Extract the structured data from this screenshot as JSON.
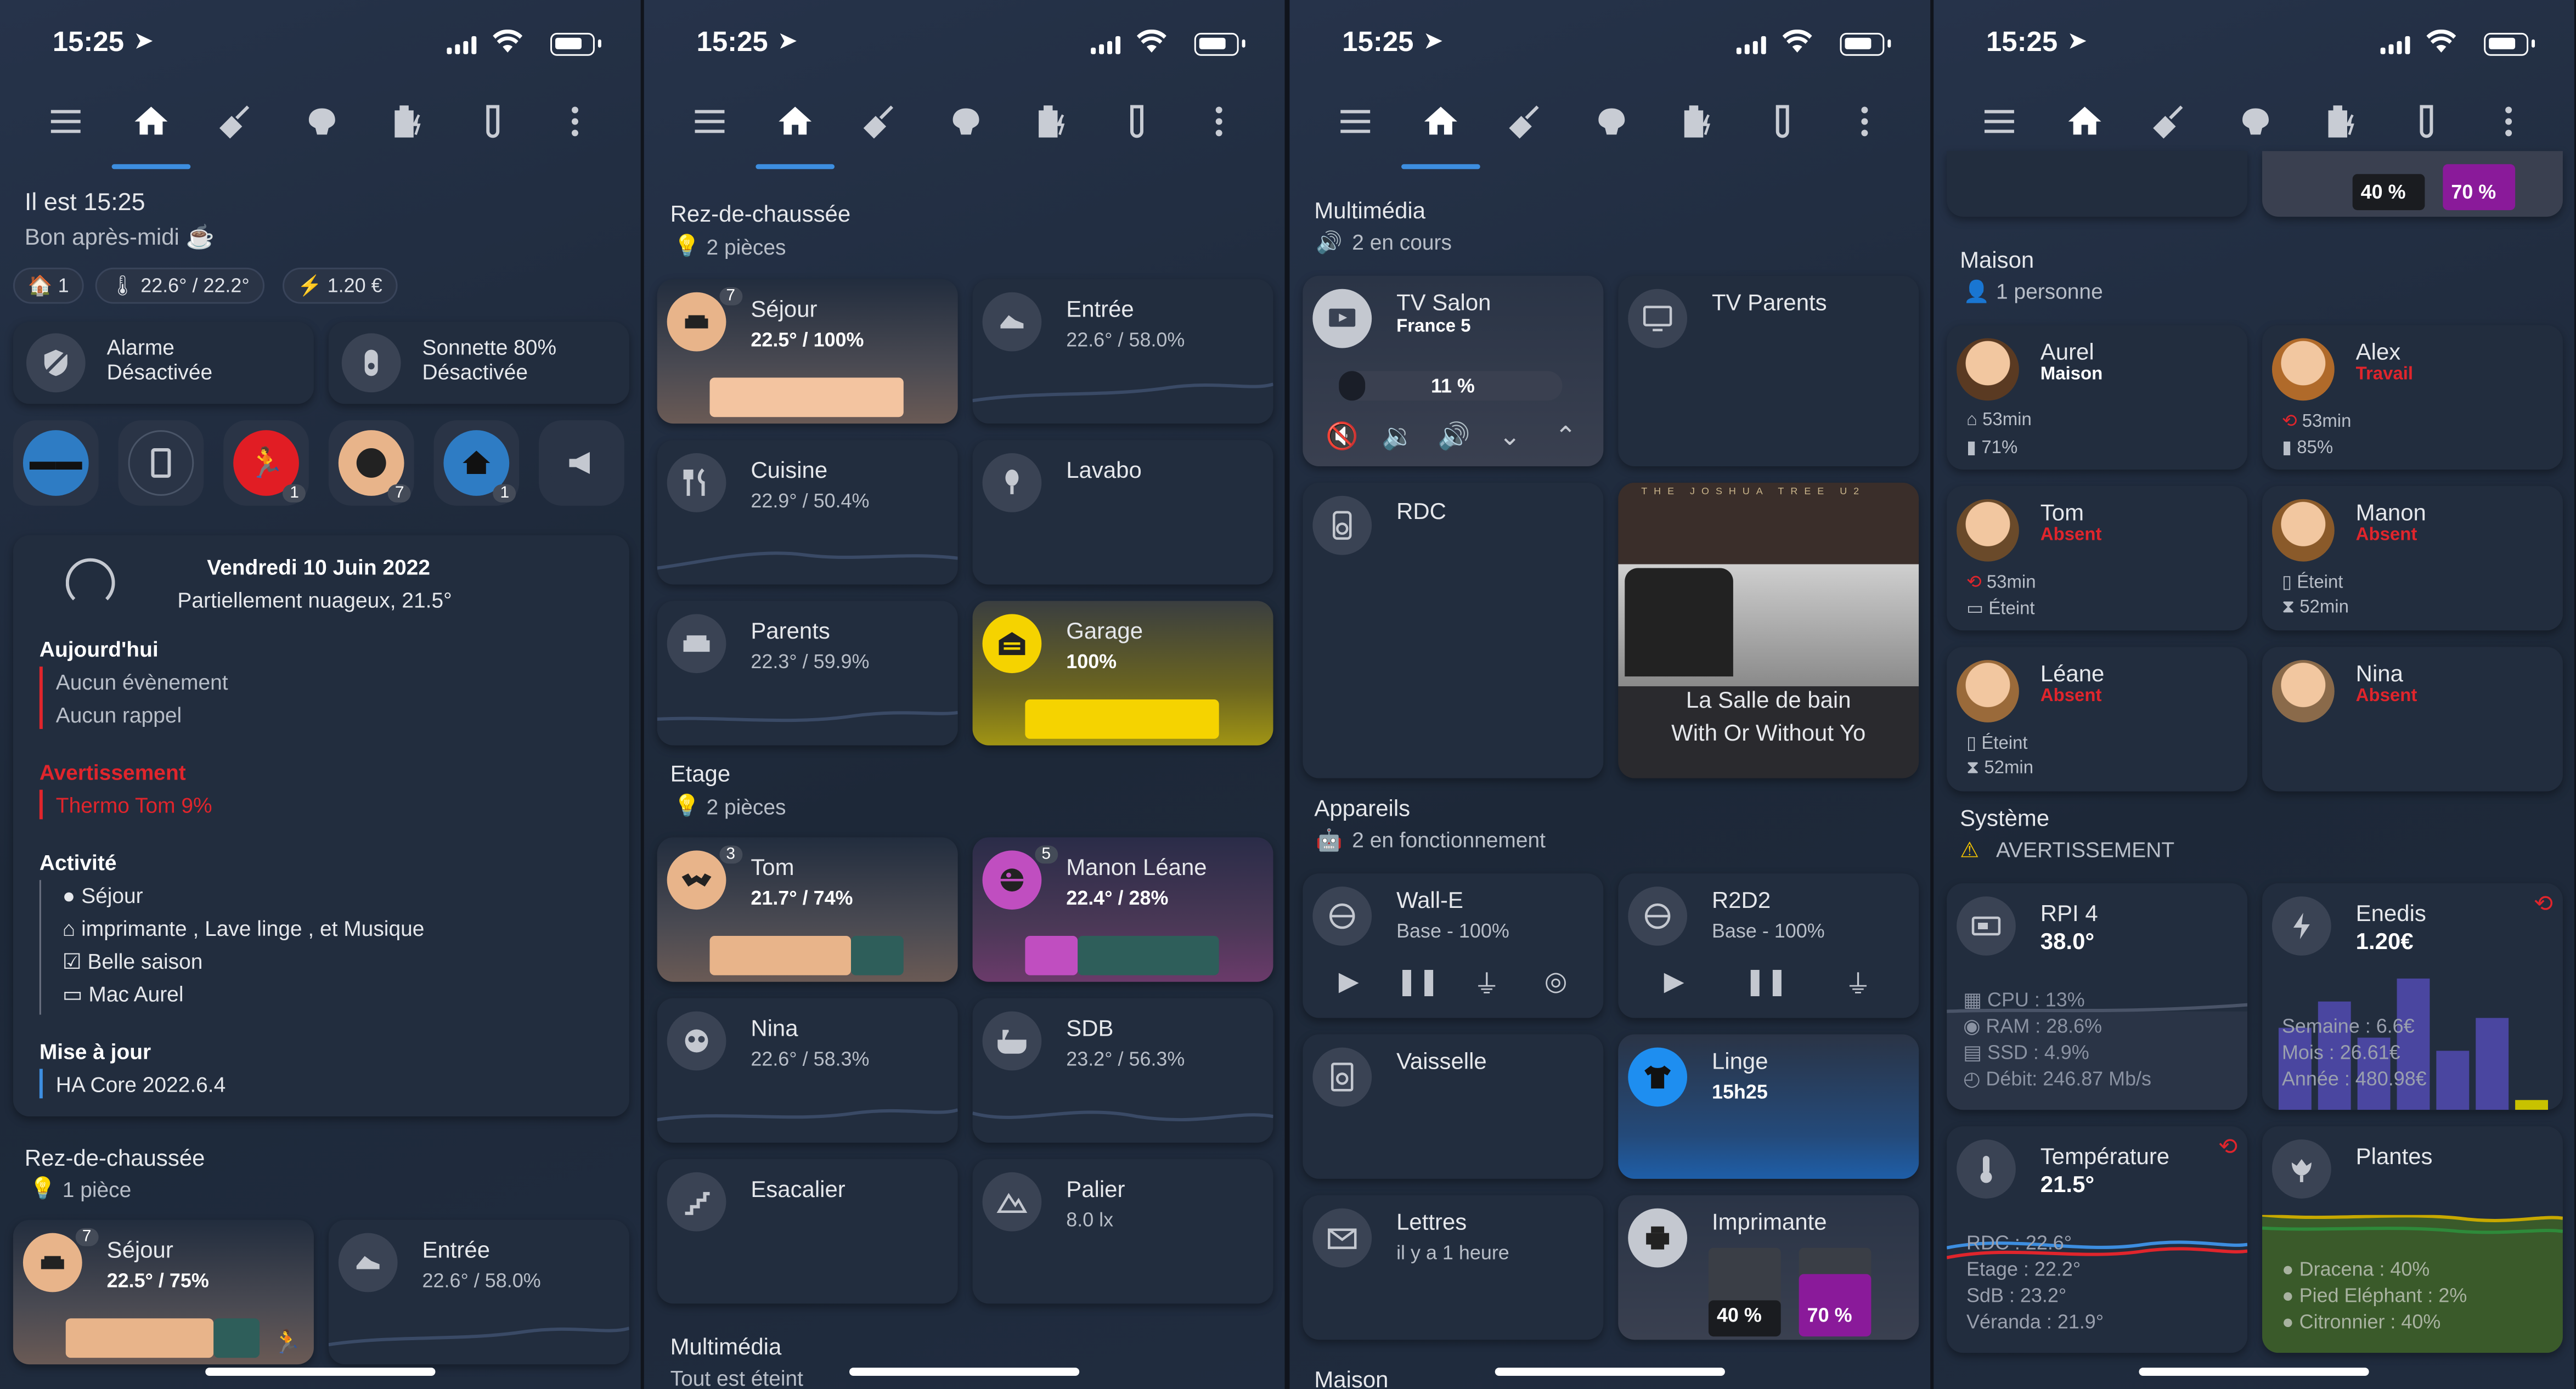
{
  "status": {
    "time": "15:25"
  },
  "p1": {
    "greeting": "Il est 15:25",
    "greeting_sub": "Bon après-midi ☕",
    "chips": [
      "🏠 1",
      "🌡 22.6° / 22.2°",
      "⚡ 1.20 €"
    ],
    "alarm_title": "Alarme",
    "alarm_state": "Désactivée",
    "bell_title": "Sonnette 80%",
    "bell_state": "Désactivée",
    "badges": [
      "1",
      "7",
      "1"
    ],
    "date": "Vendredi 10 Juin 2022",
    "weather": "Partiellement nuageux, 21.5°",
    "today": "Aujourd'hui",
    "no_event": "Aucun évènement",
    "no_reminder": "Aucun rappel",
    "warning": "Avertissement",
    "warning_item": "Thermo Tom 9%",
    "activity": "Activité",
    "activity_items": [
      "Séjour",
      "imprimante , Lave linge , et Musique",
      "Belle saison",
      "Mac Aurel"
    ],
    "update": "Mise à jour",
    "update_item": "HA Core 2022.6.4",
    "section": "Rez-de-chaussée",
    "section_sub": "1 pièce",
    "sejour_badge": "7",
    "sejour": "Séjour",
    "sejour_val": "22.5° / 75%",
    "entree": "Entrée",
    "entree_val": "22.6° / 58.0%"
  },
  "p2": {
    "rdc": "Rez-de-chaussée",
    "rdc_sub": "2 pièces",
    "rooms": [
      {
        "name": "Séjour",
        "val": "22.5° / 100%",
        "badge": "7"
      },
      {
        "name": "Entrée",
        "val": "22.6° / 58.0%"
      },
      {
        "name": "Cuisine",
        "val": "22.9° / 50.4%"
      },
      {
        "name": "Lavabo",
        "val": ""
      },
      {
        "name": "Parents",
        "val": "22.3° / 59.9%"
      },
      {
        "name": "Garage",
        "val": "100%"
      }
    ],
    "etage": "Etage",
    "etage_sub": "2 pièces",
    "rooms2": [
      {
        "name": "Tom",
        "val": "21.7° / 74%",
        "badge": "3"
      },
      {
        "name": "Manon Léane",
        "val": "22.4° / 28%",
        "badge": "5"
      },
      {
        "name": "Nina",
        "val": "22.6° / 58.3%"
      },
      {
        "name": "SDB",
        "val": "23.2° / 56.3%"
      },
      {
        "name": "Esacalier",
        "val": ""
      },
      {
        "name": "Palier",
        "val": "8.0 lx"
      }
    ],
    "multimedia": "Multimédia",
    "multimedia_sub": "Tout est éteint"
  },
  "p3": {
    "multimedia": "Multimédia",
    "multimedia_sub": "2 en cours",
    "tv_salon": "TV Salon",
    "tv_salon_ch": "France 5",
    "volume": "11 %",
    "tv_parents": "TV Parents",
    "rdc": "RDC",
    "album_top": "THE JOSHUA TREE U2",
    "media_room": "La Salle de bain",
    "media_track": "With Or Without Yo",
    "appareils": "Appareils",
    "appareils_sub": "2 en fonctionnement",
    "walle": "Wall-E",
    "walle_val": "Base - 100%",
    "r2d2": "R2D2",
    "r2d2_val": "Base - 100%",
    "vaisselle": "Vaisselle",
    "linge": "Linge",
    "linge_val": "15h25",
    "lettres": "Lettres",
    "lettres_val": "il y a 1 heure",
    "imprimante": "Imprimante",
    "ink1": "40 %",
    "ink2": "70 %",
    "maison": "Maison"
  },
  "p4": {
    "ink1": "40 %",
    "ink2": "70 %",
    "maison": "Maison",
    "maison_sub": "1 personne",
    "people": [
      {
        "name": "Aurel",
        "state": "Maison",
        "l1": "53min",
        "l2": "71%"
      },
      {
        "name": "Alex",
        "state": "Travail",
        "l1": "53min",
        "l2": "85%"
      },
      {
        "name": "Tom",
        "state": "Absent",
        "l1": "53min",
        "l2": "Éteint"
      },
      {
        "name": "Manon",
        "state": "Absent",
        "l1": "Éteint",
        "l2": "52min"
      },
      {
        "name": "Léane",
        "state": "Absent",
        "l1": "Éteint",
        "l2": "52min"
      },
      {
        "name": "Nina",
        "state": "Absent",
        "l1": "",
        "l2": ""
      }
    ],
    "systeme": "Système",
    "systeme_sub": "AVERTISSEMENT",
    "rpi": "RPI 4",
    "rpi_val": "38.0°",
    "rpi_lines": [
      "CPU : 13%",
      "RAM : 28.6%",
      "SSD : 4.9%",
      "Débit: 246.87 Mb/s"
    ],
    "enedis": "Enedis",
    "enedis_val": "1.20€",
    "enedis_lines": [
      "Semaine : 6.6€",
      "Mois : 26.61€",
      "Année : 480.98€"
    ],
    "temp": "Température",
    "temp_val": "21.5°",
    "temp_lines": [
      "RDC : 22.6°",
      "Etage : 22.2°",
      "SdB : 23.2°",
      "Véranda : 21.9°"
    ],
    "plantes": "Plantes",
    "plantes_lines": [
      "Dracena : 40%",
      "Pied Eléphant : 2%",
      "Citronnier : 40%"
    ]
  }
}
